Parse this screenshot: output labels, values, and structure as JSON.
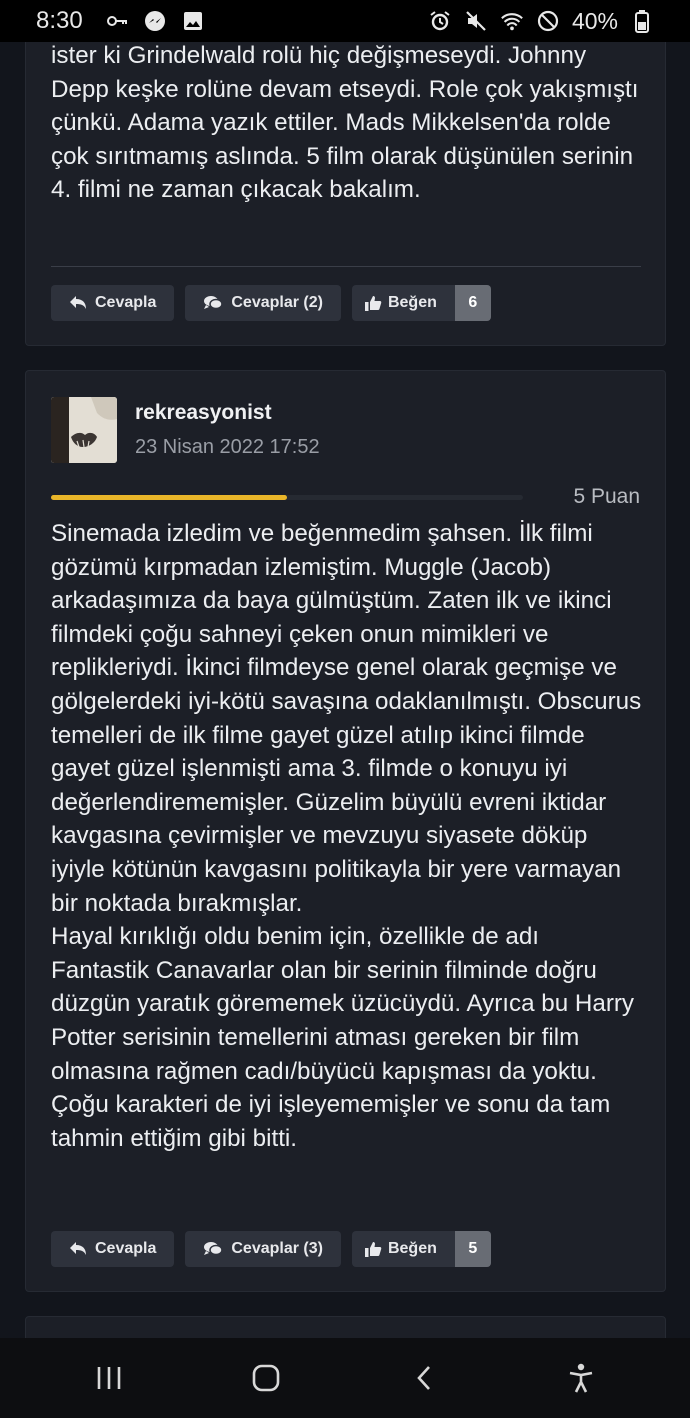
{
  "status_bar": {
    "time": "8:30",
    "battery": "40%",
    "left_icons": [
      "key-icon",
      "messenger-icon",
      "image-icon"
    ],
    "right_icons": [
      "alarm-icon",
      "mute-icon",
      "wifi-icon",
      "do-not-disturb-icon",
      "battery-icon"
    ]
  },
  "comments": [
    {
      "text": "ister ki Grindelwald rolü hiç değişmeseydi. Johnny Depp keşke rolüne devam etseydi. Role çok yakışmıştı çünkü. Adama yazık ettiler. Mads Mikkelsen'da rolde çok sırıtmamış aslında. 5 film olarak düşünülen serinin 4. filmi ne zaman çıkacak bakalım.",
      "reply_label": "Cevapla",
      "replies_label": "Cevaplar (2)",
      "like_label": "Beğen",
      "like_count": "6"
    },
    {
      "username": "rekreasyonist",
      "date": "23 Nisan 2022 17:52",
      "rating_label": "5 Puan",
      "rating_fraction": 0.5,
      "paragraphs": [
        "Sinemada izledim ve beğenmedim şahsen. İlk filmi gözümü kırpmadan izlemiştim. Muggle (Jacob) arkadaşımıza da baya gülmüştüm. Zaten ilk ve ikinci filmdeki çoğu sahneyi çeken onun mimikleri ve replikleriydi. İkinci filmdeyse genel olarak geçmişe ve gölgelerdeki iyi-kötü savaşına odaklanılmıştı. Obscurus temelleri de ilk filme gayet güzel atılıp ikinci filmde gayet güzel işlenmişti ama 3. filmde o konuyu iyi değerlendirememişler. Güzelim büyülü evreni iktidar kavgasına çevirmişler ve mevzuyu siyasete döküp iyiyle kötünün kavgasını politikayla bir yere varmayan bir noktada bırakmışlar.",
        "Hayal kırıklığı oldu benim için, özellikle de adı Fantastik Canavarlar olan bir serinin filminde doğru düzgün yaratık görememek üzücüydü. Ayrıca bu Harry Potter serisinin temellerini atması gereken bir film olmasına rağmen cadı/büyücü kapışması da yoktu. Çoğu karakteri de iyi işleyememişler ve sonu da tam tahmin ettiğim gibi bitti."
      ],
      "reply_label": "Cevapla",
      "replies_label": "Cevaplar (3)",
      "like_label": "Beğen",
      "like_count": "5"
    }
  ],
  "colors": {
    "background": "#12151c",
    "card": "#1c1f27",
    "button": "#2e323c",
    "rating_fill": "#e9b529"
  },
  "nav_bar": [
    "recent-apps-icon",
    "home-icon",
    "back-icon",
    "accessibility-icon"
  ]
}
